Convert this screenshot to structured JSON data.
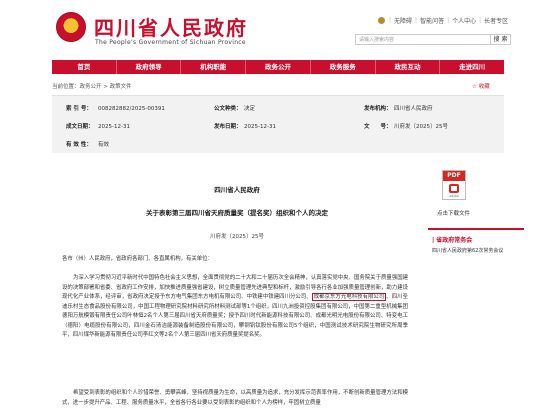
{
  "header": {
    "site_title": "四川省人民政府",
    "site_subtitle": "The People's Government of Sichuan Province",
    "top_links": [
      "无障碍",
      "智能问答",
      "个人中心",
      "长者专区"
    ],
    "search_placeholder": "请输入搜索内容",
    "search_button": "搜 索"
  },
  "nav": {
    "items": [
      "首页",
      "政府领导",
      "机构职能",
      "政务公开",
      "政务服务",
      "政民互动",
      "走进四川"
    ]
  },
  "breadcrumb": {
    "text": "当前位置：政务公开 > 政策文件"
  },
  "collect_label": "收藏",
  "meta": {
    "index_label": "索 引 号：",
    "index_value": "008282882/2025-00391",
    "category_label": "公文种类：",
    "category_value": "决定",
    "issuer_label": "发布机构：",
    "issuer_value": "四川省人民政府",
    "date_label": "成文日期：",
    "date_value": "2025-12-31",
    "publish_label": "发布日期：",
    "publish_value": "2025-12-31",
    "docno_label": "文　　号：",
    "docno_value": "川府发〔2025〕25号",
    "validity_label": "有 效 性：",
    "validity_value": "有效"
  },
  "document": {
    "from": "四川省人民政府",
    "title": "关于表彰第三届四川省天府质量奖（提名奖）组织和个人的决定",
    "number": "川府发〔2025〕25号",
    "addressee": "各市（州）人民政府，省政府各部门、各直属机构，有关单位：",
    "para1_a": "为深入学习贯彻习近平新时代中国特色社会主义思想，全面贯彻党的二十大和二十届历次全会精神，认真落实党中央、国务院关于质量强国建设的决策部署和省委、省政府工作安排，加快推进质量强省建设，树立质量管理先进典型和标杆，激励引导各行各业加强质量管理创新，助力建设现代化产业体系，经评审，省政府决定授予东方电气集团东方电机有限公司、中铁建中铁建四川分公司、",
    "para1_hl": "成都京东方光电科技有限公司",
    "para1_b": "、四川圣迪乐村生态食品股份有限公司，中国工程物理研究院材料研究所材料测试部等1个组织，四川九洲投资控股集团有限公司，中国第二重型机械集团德阳万航模锻有限责任公司叶林恒2名个人第三届四川省天府质量奖；授予四川时代新能源科技有限公司、成都光明光电股份有限公司、特变电工（德阳）电缆股份有限公司，四川金石清洁能源装备制造股份有限公司，攀钢钒钛股份有限公司5个组织，中国测试技术研究院生物研究所周季平，四川煤华新能源有限责任公司李红文等2名个人第三届四川省天府质量奖提名奖。",
    "para2": "希望受到表彰的组织和个人珍惜荣誉、勇攀高峰，坚持视质量为生命，以高质量为追求，充分发挥示范表率作用，不断创新质量管理方法和模式，进一步提升产品、工程、服务质量水平，全省各行各业要以受到表彰的组织和个人为榜样，牢固树立质量"
  },
  "attachment": {
    "icon_text": "PDF",
    "icon_brand": "Adobe",
    "label": "点击下载文件"
  },
  "sidebar": {
    "title": "| 省政府常务会",
    "item": "四川省人民政府第62次常务会议"
  },
  "colors": {
    "brand_red": "#c8102e",
    "meta_bg": "#f2f2f2"
  }
}
